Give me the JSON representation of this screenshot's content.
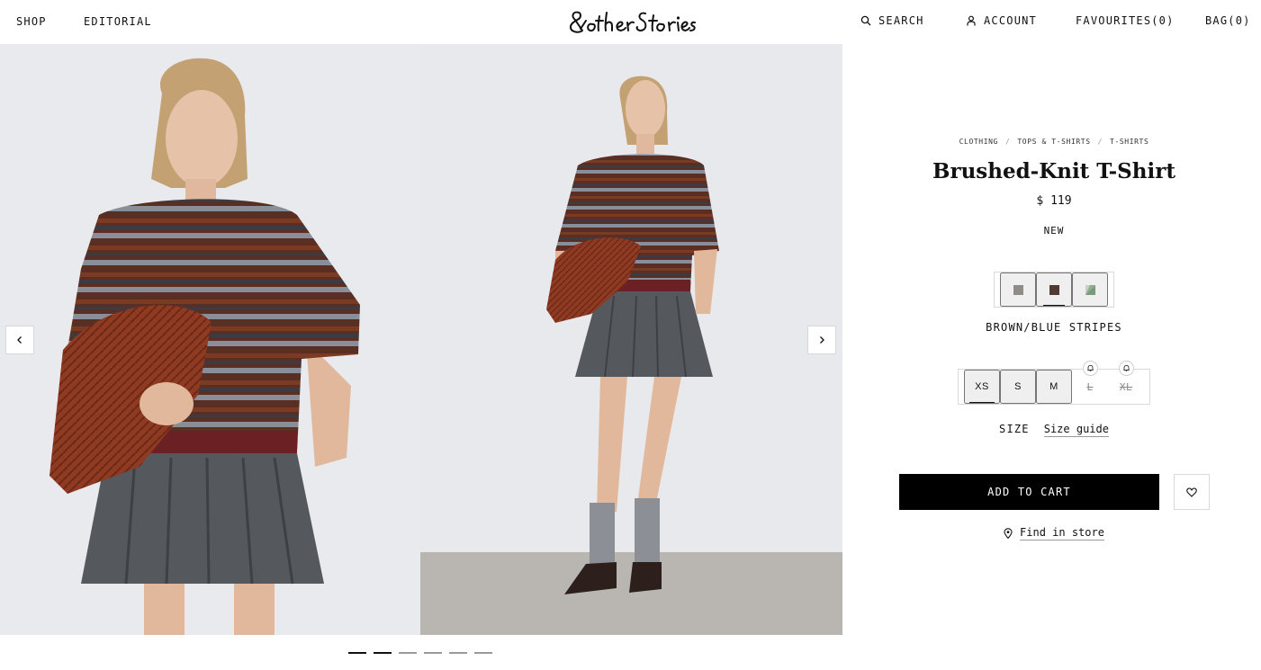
{
  "header": {
    "nav": [
      "SHOP",
      "EDITORIAL"
    ],
    "logo_text": "& other Stories",
    "search_label": "SEARCH",
    "account_label": "ACCOUNT",
    "favourites_label": "FAVOURITES(0)",
    "bag_label": "BAG(0)"
  },
  "gallery": {
    "prev_icon": "chevron-left-icon",
    "next_icon": "chevron-right-icon",
    "slide_count": 6,
    "active_slides": [
      1,
      2
    ]
  },
  "product": {
    "breadcrumbs": [
      "CLOTHING",
      "TOPS & T-SHIRTS",
      "T-SHIRTS"
    ],
    "breadcrumb_separator": "/",
    "name": "Brushed-Knit T-Shirt",
    "price": "$ 119",
    "badge": "NEW",
    "colors": [
      {
        "swatch": "#8f8c88",
        "pattern": "solid"
      },
      {
        "swatch": "#4f3b33",
        "pattern": "solid",
        "selected": true
      },
      {
        "swatch": "#7b9a7c",
        "pattern": "diagonal"
      }
    ],
    "selected_color": "BROWN/BLUE STRIPES",
    "sizes": [
      {
        "label": "XS",
        "available": true,
        "selected": true
      },
      {
        "label": "S",
        "available": true
      },
      {
        "label": "M",
        "available": true
      },
      {
        "label": "L",
        "available": false,
        "notify_icon": "bell-icon"
      },
      {
        "label": "XL",
        "available": false,
        "notify_icon": "bell-icon"
      }
    ],
    "size_label": "SIZE",
    "size_guide": "Size guide",
    "add_to_cart": "ADD TO CART",
    "favourite_icon": "heart-icon",
    "find_in_store": "Find in store"
  }
}
